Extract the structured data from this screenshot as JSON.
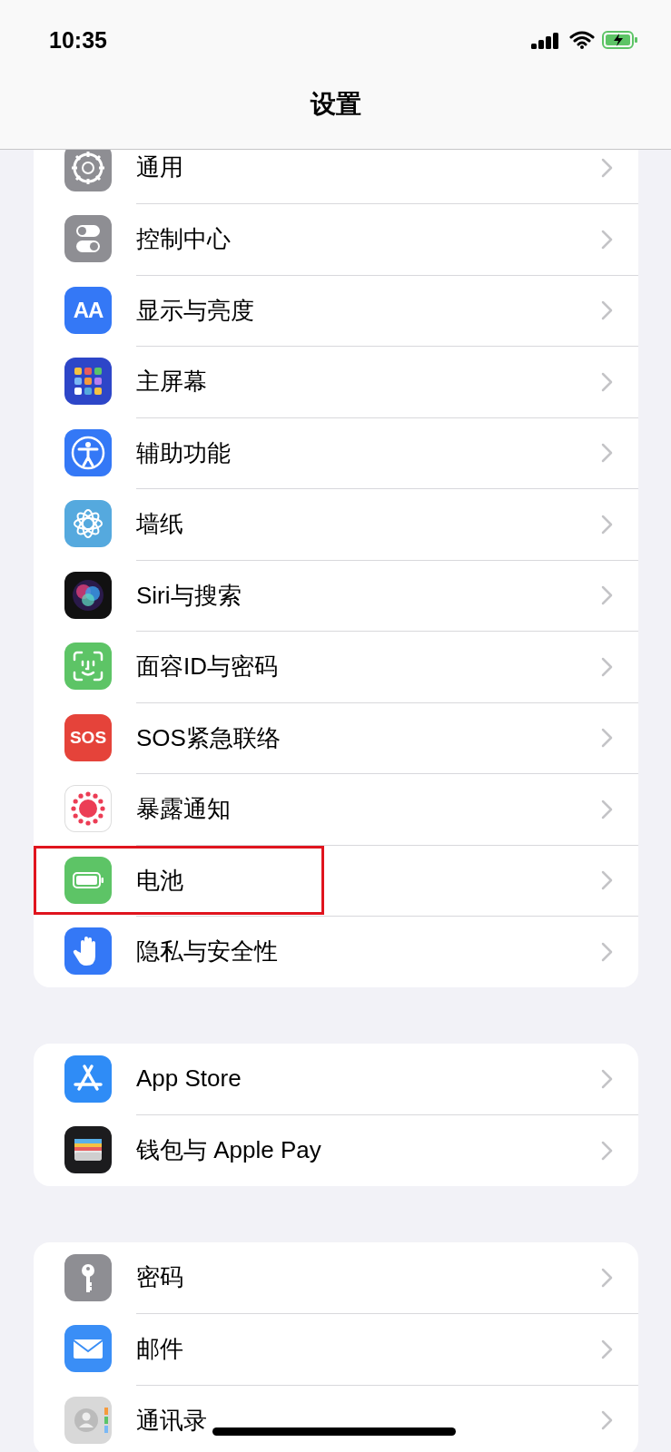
{
  "status_bar": {
    "time": "10:35"
  },
  "nav": {
    "title": "设置"
  },
  "sections": [
    {
      "rows": [
        {
          "label": "通用",
          "kind": "gear",
          "highlighted": false
        },
        {
          "label": "控制中心",
          "kind": "toggles",
          "highlighted": false
        },
        {
          "label": "显示与亮度",
          "kind": "display",
          "icon_text": "AA",
          "highlighted": false
        },
        {
          "label": "主屏幕",
          "kind": "home",
          "highlighted": false
        },
        {
          "label": "辅助功能",
          "kind": "accessibility",
          "highlighted": false
        },
        {
          "label": "墙纸",
          "kind": "flower",
          "highlighted": false
        },
        {
          "label": "Siri与搜索",
          "kind": "siri",
          "highlighted": false
        },
        {
          "label": "面容ID与密码",
          "kind": "face",
          "highlighted": false
        },
        {
          "label": "SOS紧急联络",
          "kind": "sos",
          "icon_text": "SOS",
          "highlighted": false
        },
        {
          "label": "暴露通知",
          "kind": "exposure",
          "highlighted": false
        },
        {
          "label": "电池",
          "kind": "battery",
          "highlighted": true
        },
        {
          "label": "隐私与安全性",
          "kind": "hand",
          "highlighted": false
        }
      ]
    },
    {
      "rows": [
        {
          "label": "App Store",
          "kind": "appstore",
          "highlighted": false
        },
        {
          "label": "钱包与 Apple Pay",
          "kind": "wallet",
          "highlighted": false
        }
      ]
    },
    {
      "rows": [
        {
          "label": "密码",
          "kind": "key",
          "highlighted": false
        },
        {
          "label": "邮件",
          "kind": "mail",
          "highlighted": false
        },
        {
          "label": "通讯录",
          "kind": "contacts",
          "highlighted": false
        }
      ]
    }
  ]
}
